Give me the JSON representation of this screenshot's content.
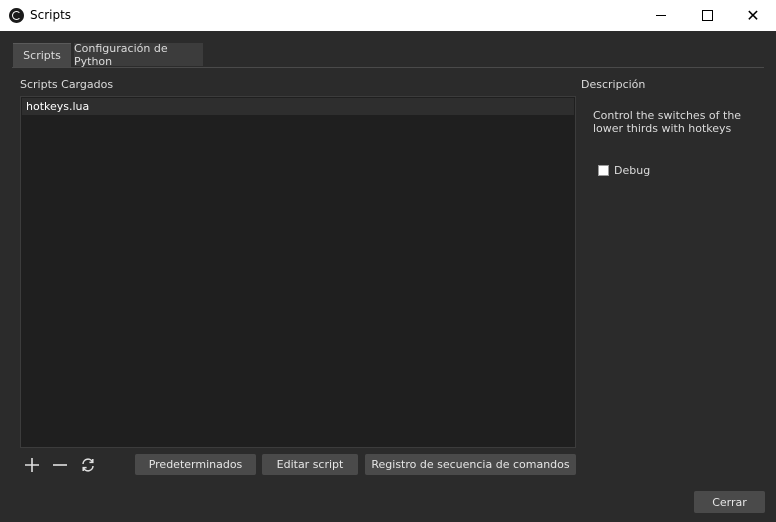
{
  "window": {
    "title": "Scripts",
    "minimize_icon": "minimize-icon",
    "maximize_icon": "maximize-icon",
    "close_icon": "close-icon",
    "close_glyph": "✕"
  },
  "tabs": [
    {
      "label": "Scripts",
      "active": true
    },
    {
      "label": "Configuración de Python",
      "active": false
    }
  ],
  "scripts_panel": {
    "label": "Scripts Cargados",
    "items": [
      "hotkeys.lua"
    ],
    "add_icon": "plus-icon",
    "remove_icon": "minus-icon",
    "reload_icon": "reload-icon"
  },
  "buttons": {
    "defaults": "Predeterminados",
    "edit": "Editar script",
    "log": "Registro de secuencia de comandos",
    "close": "Cerrar"
  },
  "description": {
    "label": "Descripción",
    "text": "Control the switches of the lower thirds with hotkeys",
    "debug_label": "Debug",
    "debug_checked": false
  }
}
